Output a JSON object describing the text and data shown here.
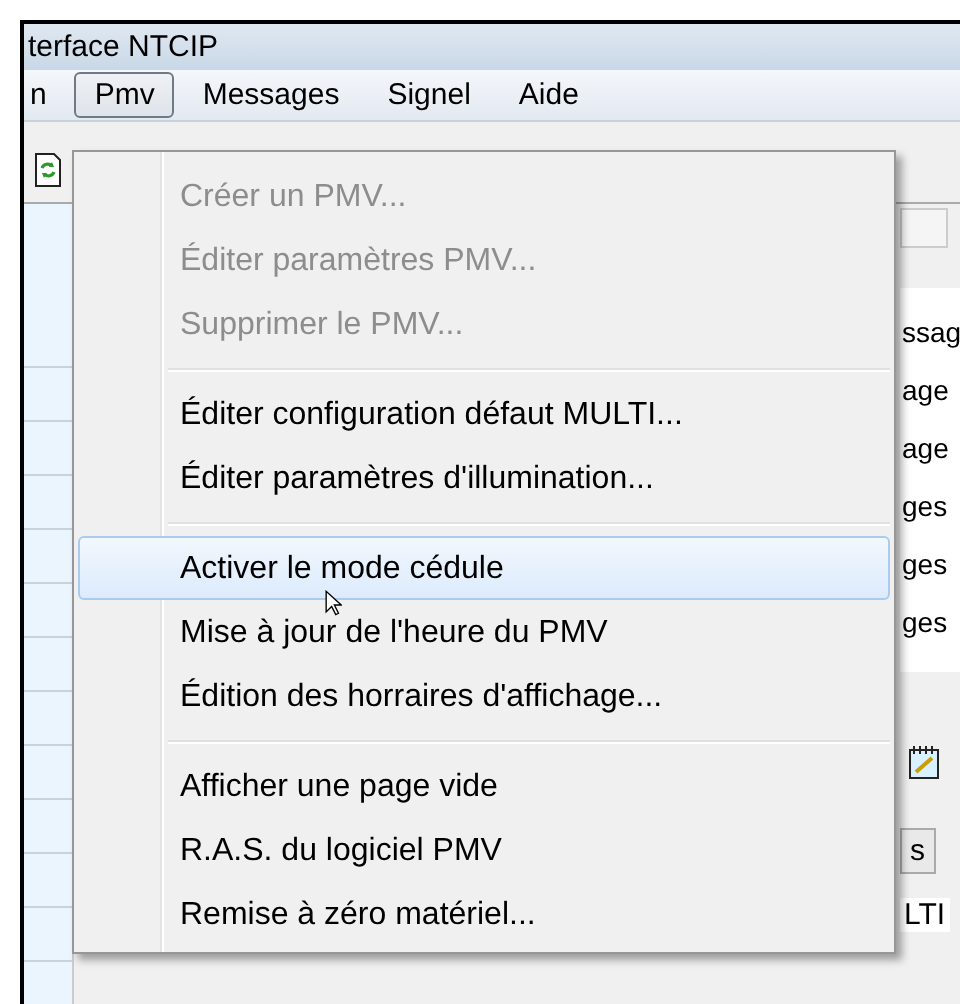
{
  "window": {
    "title": "terface NTCIP"
  },
  "menu_bar": [
    {
      "label": "n",
      "selected": false
    },
    {
      "label": "Pmv",
      "selected": true
    },
    {
      "label": "Messages",
      "selected": false
    },
    {
      "label": "Signel",
      "selected": false
    },
    {
      "label": "Aide",
      "selected": false
    }
  ],
  "menu": {
    "groups": [
      [
        {
          "label": "Créer un PMV...",
          "disabled": true,
          "selected": false
        },
        {
          "label": "Éditer paramètres PMV...",
          "disabled": true,
          "selected": false
        },
        {
          "label": "Supprimer le PMV...",
          "disabled": true,
          "selected": false
        }
      ],
      [
        {
          "label": "Éditer configuration défaut MULTI...",
          "disabled": false,
          "selected": false
        },
        {
          "label": "Éditer paramètres d'illumination...",
          "disabled": false,
          "selected": false
        }
      ],
      [
        {
          "label": "Activer le mode cédule",
          "disabled": false,
          "selected": true
        },
        {
          "label": "Mise à jour de l'heure du PMV",
          "disabled": false,
          "selected": false
        },
        {
          "label": "Édition des horraires d'affichage...",
          "disabled": false,
          "selected": false
        }
      ],
      [
        {
          "label": "Afficher une page vide",
          "disabled": false,
          "selected": false
        },
        {
          "label": "R.A.S. du logiciel PMV",
          "disabled": false,
          "selected": false
        },
        {
          "label": "Remise à zéro matériel...",
          "disabled": false,
          "selected": false
        }
      ]
    ]
  },
  "background": {
    "list_fragments": [
      "ssag",
      "age",
      "age",
      "ges",
      "ges",
      "ges"
    ],
    "tab_fragment": "s",
    "column_fragment": "LTI"
  }
}
